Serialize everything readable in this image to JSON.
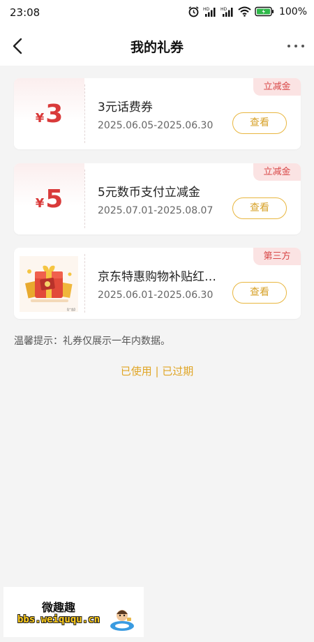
{
  "status_bar": {
    "time": "23:08",
    "battery": "100%",
    "icons": [
      "alarm-icon",
      "hd-signal-icon",
      "hd-signal-icon",
      "wifi-icon",
      "battery-icon"
    ]
  },
  "header": {
    "title": "我的礼券",
    "back_icon": "chevron-left-icon",
    "more_icon": "more-dots-icon"
  },
  "coupons": [
    {
      "currency": "¥",
      "amount": "3",
      "name": "3元话费券",
      "date_range": "2025.06.05-2025.06.30",
      "tag": "立减金",
      "button": "查看"
    },
    {
      "currency": "¥",
      "amount": "5",
      "name": "5元数币支付立减金",
      "date_range": "2025.07.01-2025.08.07",
      "tag": "立减金",
      "button": "查看"
    },
    {
      "image": "gift-box-image",
      "name": "京东特惠购物补贴红…",
      "date_range": "2025.06.01-2025.06.30",
      "tag": "第三方",
      "button": "查看"
    }
  ],
  "tip": "温馨提示：礼券仅展示一年内数据。",
  "bottom_links": {
    "used": "已使用",
    "separator": " | ",
    "expired": "已过期"
  },
  "watermark": {
    "title": "微趣趣",
    "url": "bbs.weiququ.cn"
  },
  "colors": {
    "accent_gold": "#e0a524",
    "amount_red": "#d93a3a",
    "tag_bg": "#fbe3e3",
    "page_bg": "#f4f4f4"
  }
}
